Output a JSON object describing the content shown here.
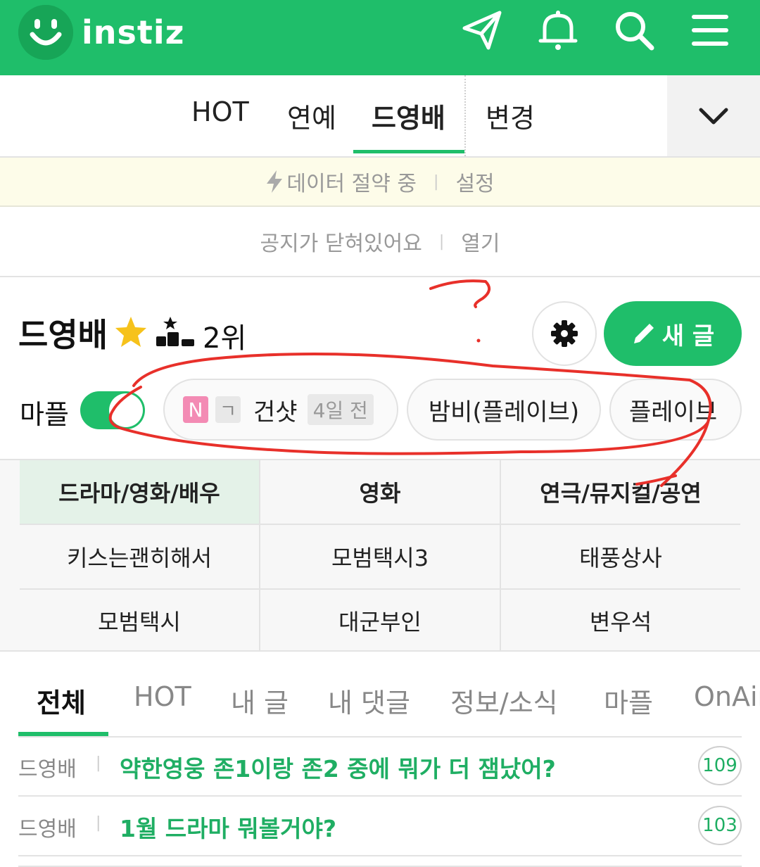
{
  "header": {
    "logo_text": "instiz",
    "icons": [
      "send-icon",
      "bell-icon",
      "search-icon",
      "menu-icon"
    ],
    "brand_color": "#1fbe6a"
  },
  "category_nav": {
    "tabs": [
      {
        "label": "HOT"
      },
      {
        "label": "연예"
      },
      {
        "label": "드영배"
      },
      {
        "label": "변경"
      }
    ],
    "active": "드영배"
  },
  "data_bar": {
    "status": "데이터 절약 중",
    "settings": "설정"
  },
  "notice_bar": {
    "text": "공지가 닫혀있어요",
    "open": "열기"
  },
  "board": {
    "title": "드영배",
    "rank": "2위",
    "write_label": "새 글"
  },
  "toggle_row": {
    "label": "마플",
    "toggle_on": true,
    "chips": [
      {
        "badge_n": "N",
        "badge_g": "ㄱ",
        "text": "건샷",
        "time": "4일 전"
      },
      {
        "text": "밤비(플레이브)"
      },
      {
        "text": "플레이브"
      }
    ]
  },
  "subcategories": [
    [
      "드라마/영화/배우",
      "영화",
      "연극/뮤지컬/공연"
    ],
    [
      "키스는괜히해서",
      "모범택시3",
      "태풍상사"
    ],
    [
      "모범택시",
      "대군부인",
      "변우석"
    ]
  ],
  "list_tabs": [
    "전체",
    "HOT",
    "내 글",
    "내 댓글",
    "정보/소식",
    "마플",
    "OnAir"
  ],
  "posts": [
    {
      "board": "드영배",
      "title": "약한영웅 존1이랑 존2 중에 뭐가 더 잼났어?",
      "count": "109"
    },
    {
      "board": "드영배",
      "title": "1월 드라마 뭐볼거야?",
      "count": "103"
    }
  ],
  "annotation": {
    "mark": "?",
    "color": "#e8302a"
  }
}
